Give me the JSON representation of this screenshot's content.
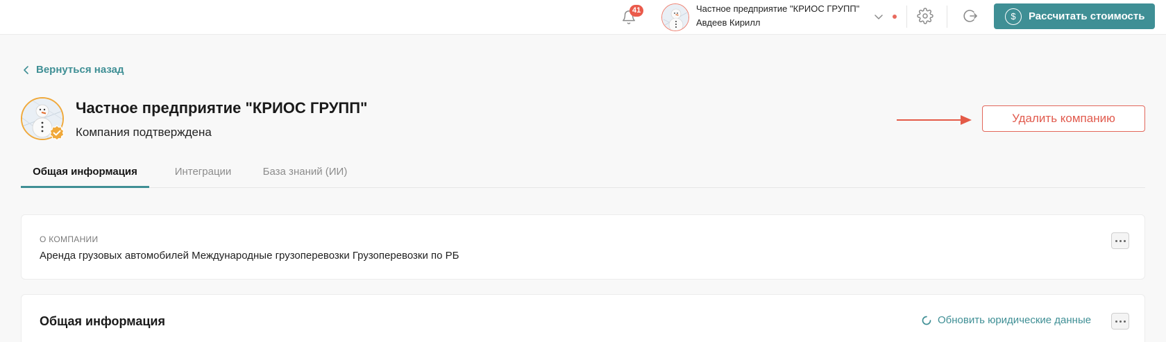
{
  "topbar": {
    "notifications_count": "41",
    "user": {
      "company": "Частное предприятие \"КРИОС ГРУПП\"",
      "name": "Авдеев Кирилл"
    },
    "calc_button_label": "Рассчитать стоимость",
    "calc_icon_glyph": "$"
  },
  "header": {
    "back_label": "Вернуться назад",
    "company_title": "Частное предприятие \"КРИОС ГРУПП\"",
    "company_status": "Компания подтверждена",
    "delete_label": "Удалить компанию"
  },
  "tabs": [
    {
      "label": "Общая информация",
      "active": true
    },
    {
      "label": "Интеграции",
      "active": false
    },
    {
      "label": "База знаний (ИИ)",
      "active": false
    }
  ],
  "about": {
    "label": "О компании",
    "text": "Аренда грузовых автомобилей Международные грузоперевозки Грузоперевозки по РБ"
  },
  "general": {
    "title": "Общая информация",
    "refresh_label": "Обновить юридические данные"
  },
  "colors": {
    "accent": "#3f8f95",
    "danger": "#e15a4d",
    "badge": "#ea5a4b",
    "verified": "#f0a93b"
  },
  "icons": {
    "notifications": "bell-icon",
    "settings": "gear-icon",
    "logout": "logout-icon",
    "back": "chevron-left-icon",
    "dropdown": "chevron-down-icon",
    "refresh": "refresh-icon",
    "more": "more-dots-icon",
    "verified": "verified-check-icon"
  }
}
